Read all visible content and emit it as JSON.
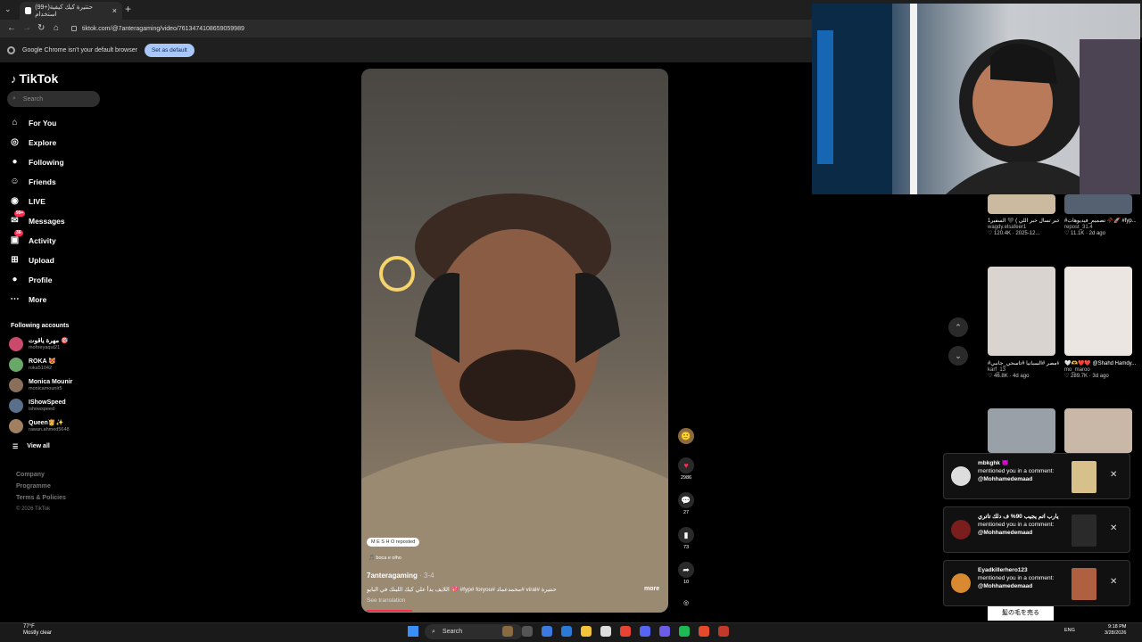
{
  "browser": {
    "tab_title": "(99+)حنتيرة كيك كيفية استخدام",
    "url": "tiktok.com/@7anteragaming/video/7613474108659059989",
    "infobar_text": "Google Chrome isn't your default browser",
    "set_default_label": "Set as default"
  },
  "sidebar": {
    "logo": "TikTok",
    "search_placeholder": "Search",
    "nav": [
      {
        "label": "For You",
        "icon": "home-icon"
      },
      {
        "label": "Explore",
        "icon": "compass-icon"
      },
      {
        "label": "Following",
        "icon": "following-icon"
      },
      {
        "label": "Friends",
        "icon": "friends-icon"
      },
      {
        "label": "LIVE",
        "icon": "live-icon"
      },
      {
        "label": "Messages",
        "icon": "messages-icon",
        "badge": "99+"
      },
      {
        "label": "Activity",
        "icon": "activity-icon",
        "badge": "36"
      },
      {
        "label": "Upload",
        "icon": "upload-icon"
      },
      {
        "label": "Profile",
        "icon": "profile-icon"
      },
      {
        "label": "More",
        "icon": "more-icon"
      }
    ],
    "following_title": "Following accounts",
    "accounts": [
      {
        "name": "مهرة ياقوت 🎯",
        "handle": "mohreyaqut21",
        "color": "#c94a6a"
      },
      {
        "name": "ROKA 😻",
        "handle": "roka51042",
        "color": "#6aa86a"
      },
      {
        "name": "Monica Mounir",
        "handle": "monicamounir5",
        "color": "#8a6f5a"
      },
      {
        "name": "IShowSpeed",
        "handle": "ishowspeed",
        "color": "#5a6f8a"
      },
      {
        "name": "Queen👸✨",
        "handle": "rawan.ahmed5648",
        "color": "#a08060"
      }
    ],
    "view_all": "View all",
    "footer": [
      "Company",
      "Programme",
      "Terms & Policies"
    ],
    "copyright": "© 2026 TikTok"
  },
  "video": {
    "reposted": "M E S H O reposted",
    "music": "boca e olho",
    "author": "7anteragaming",
    "date": "3-4",
    "caption": "اللايف بدأ علي كيك اللينك في البايو 💖 #fyp# foryou# محمدعماد# viral# حنتيرة",
    "more": "more",
    "see_translation": "See translation",
    "progress": 0.15
  },
  "actions": {
    "likes": "2986",
    "comments": "27",
    "saves": "73",
    "shares": "10"
  },
  "grid": [
    {
      "title": "قصة جديدة ( خبر تسال خبر اللي ) 🖤 السفير1",
      "user": "wagdy.elsafeer1",
      "stats": "120.4K · 2025-12...",
      "color": "#cbb9a0"
    },
    {
      "title": "#تصميم_فيديوهات 🥀🚀 #fyp...",
      "user": "repost_31.4",
      "stats": "11.1K · 2d ago",
      "color": "#556070"
    },
    {
      "title": "#منتخب_مصر #مصر #السبانيا #تاسحي_جانبي...",
      "user": "karf_13",
      "stats": "46.8K · 4d ago",
      "color": "#d9d4cf"
    },
    {
      "title": "🤍🫶❤️❤️ @Shahd Hamdy...",
      "user": "mo_maroo",
      "stats": "289.7K · 3d ago",
      "color": "#ece6e2"
    },
    {
      "title": "",
      "user": "",
      "stats": "",
      "color": "#9aa0a8"
    },
    {
      "title": "",
      "user": "",
      "stats": "",
      "color": "#c9b8a8"
    }
  ],
  "notifications": [
    {
      "user": "mbkghk 😈",
      "line": "mentioned you in a comment:",
      "mention": "@Mohhamedemaad",
      "color": "#dddddd",
      "thumb": "#d8c08a"
    },
    {
      "user": "يارب اتم يجيب 90% ف دلك تاتري",
      "line": "mentioned you in a comment:",
      "mention": "@Mohhamedemaad",
      "color": "#7a1d1d",
      "thumb": "#2a2a2a"
    },
    {
      "user": "Eyadkillerhero123",
      "line": "mentioned you in a comment:",
      "mention": "@Mohhamedemaad",
      "color": "#d98a30",
      "thumb": "#b06040"
    }
  ],
  "bottom_text": "髪の毛を売る",
  "taskbar": {
    "weather_temp": "77°F",
    "weather_desc": "Mostly clear",
    "search": "Search",
    "lang": "ENG",
    "time": "9:18 PM",
    "date": "3/28/2026"
  }
}
